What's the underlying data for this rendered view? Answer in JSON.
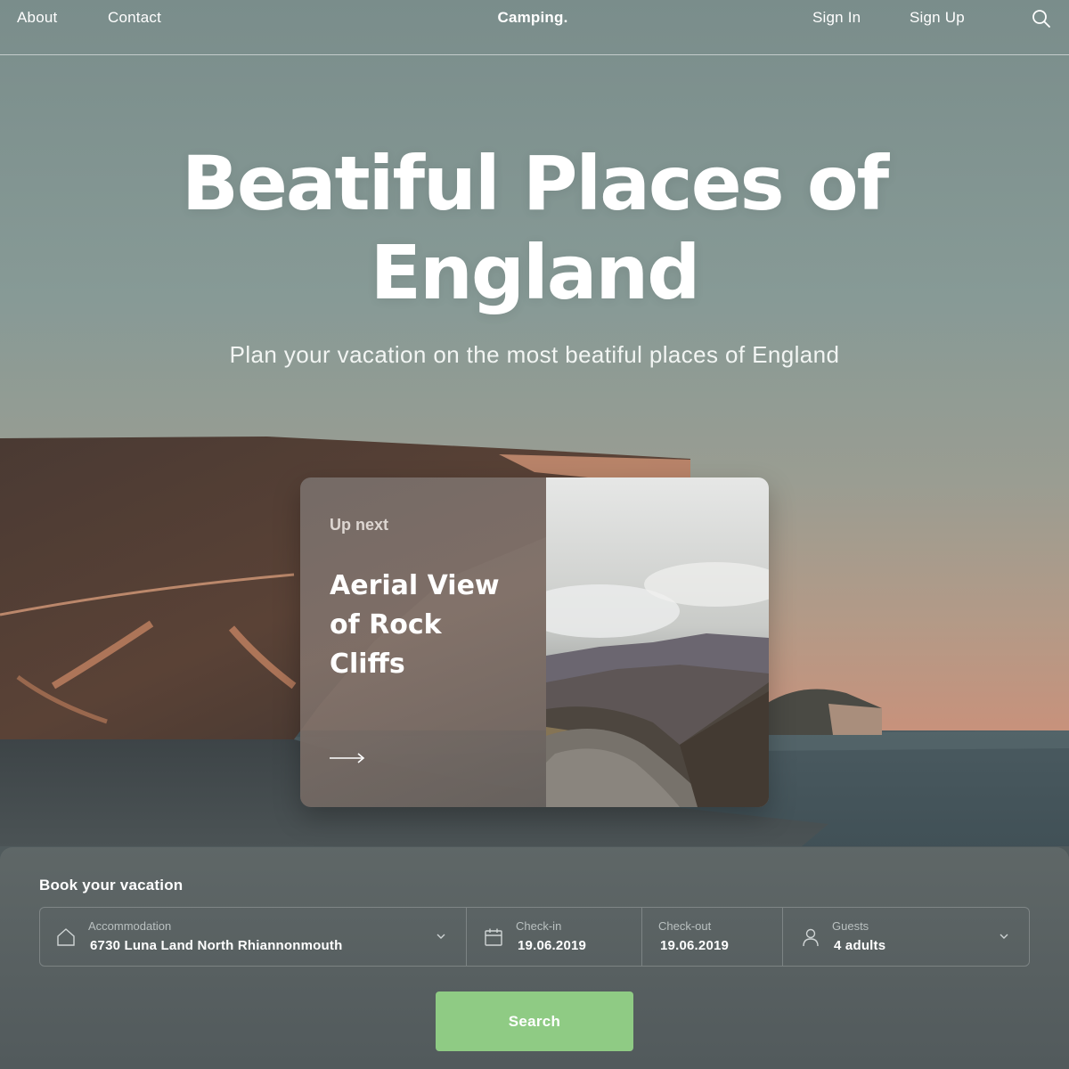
{
  "nav": {
    "about": "About",
    "contact": "Contact",
    "brand": "Camping.",
    "sign_in": "Sign In",
    "sign_up": "Sign Up",
    "search_icon": "search-icon"
  },
  "hero": {
    "title_line1": "Beatiful Places of",
    "title_line2": "England",
    "subtitle": "Plan your vacation on the most beatiful places of England"
  },
  "card": {
    "eyebrow": "Up next",
    "title_line1": "Aerial View",
    "title_line2": "of Rock",
    "title_line3": "Cliffs",
    "arrow_icon": "arrow-right-icon"
  },
  "booking": {
    "title": "Book your vacation",
    "accommodation": {
      "label": "Accommodation",
      "value": "6730 Luna Land North Rhiannonmouth",
      "icon": "home-icon"
    },
    "checkin": {
      "label": "Check-in",
      "value": "19.06.2019",
      "icon": "calendar-icon"
    },
    "checkout": {
      "label": "Check-out",
      "value": "19.06.2019"
    },
    "guests": {
      "label": "Guests",
      "value": "4 adults",
      "icon": "user-icon"
    },
    "search_label": "Search"
  },
  "colors": {
    "accent_green": "#8fcb84",
    "sky": "#7d918e",
    "panel": "#5a6364"
  }
}
